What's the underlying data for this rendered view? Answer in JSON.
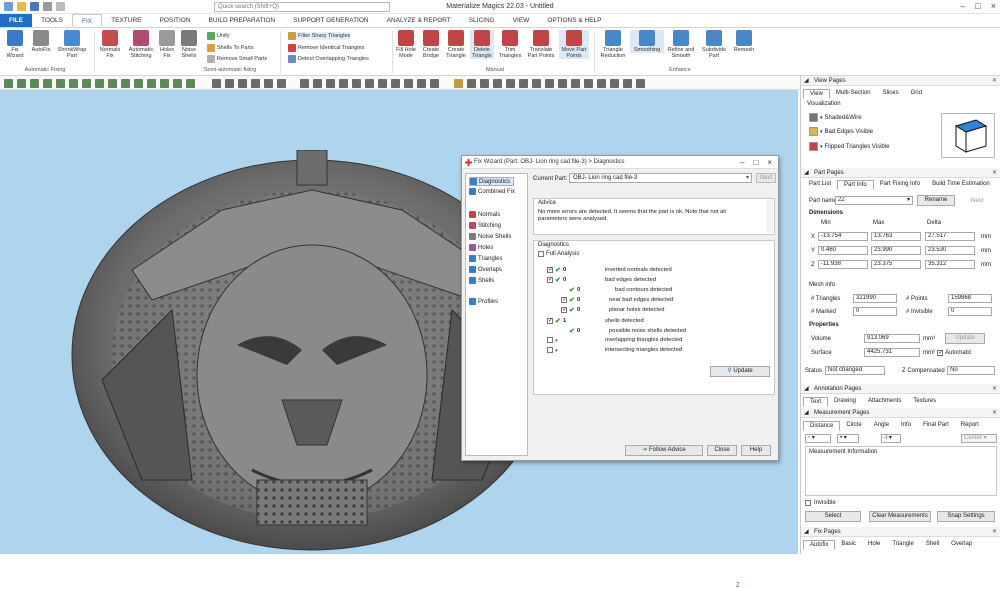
{
  "app": {
    "title": "Materialize Magics 22.03 - Untitled",
    "search_placeholder": "Quick search (Shift+Q)"
  },
  "menu": [
    "FILE",
    "TOOLS",
    "FIX",
    "TEXTURE",
    "POSITION",
    "BUILD PREPARATION",
    "SUPPORT GENERATION",
    "ANALYZE & REPORT",
    "SLICING",
    "VIEW",
    "OPTIONS & HELP"
  ],
  "ribbon": {
    "auto_fixing": {
      "label": "Automatic Fixing",
      "buttons": [
        "Fix Wizard",
        "AutoFix",
        "ShrinkWrap Part"
      ]
    },
    "semi": {
      "label": "Semi-automatic fixing",
      "buttons": [
        "Normals Fix",
        "Automatic Stitching",
        "Holes Fix",
        "Noise Shells"
      ],
      "small": [
        "Unify",
        "Shells To Parts",
        "Remove Small Parts"
      ]
    },
    "filters": [
      "Filter Sharp Triangles",
      "Remove Identical Triangles",
      "Detect Overlapping Triangles"
    ],
    "manual": {
      "label": "Manual",
      "buttons": [
        "Fill Hole Mode",
        "Create Bridge",
        "Create Triangle",
        "Delete Triangle",
        "Trim Triangles",
        "Translate Part Points",
        "Move Part Points"
      ]
    },
    "enhance": {
      "label": "Enhance",
      "buttons": [
        "Triangle Reduction",
        "Smoothing",
        "Refine and Smooth",
        "Subdivide Part",
        "Remesh"
      ]
    }
  },
  "dialog": {
    "title": "Fix Wizard (Part: OBJ- Lion ring cad file-3) > Diagnostics",
    "nav": [
      "Diagnostics",
      "Combined Fix",
      "Normals",
      "Stitching",
      "Noise Shells",
      "Holes",
      "Triangles",
      "Overlaps",
      "Shells",
      "Profiles"
    ],
    "current_part_label": "Current Part:",
    "current_part": "OBJ- Lion ring cad file-3",
    "next": "Next",
    "advice_title": "Advice",
    "advice_text": "No more errors are detected. It seems that the part is ok. Note that not all parameters were analysed.",
    "diag_title": "Diagnostics",
    "full_analysis": "Full Analysis",
    "rows": [
      {
        "count": "0",
        "label": "inverted normals detected"
      },
      {
        "count": "0",
        "label": "bad edges detected"
      },
      {
        "count": "0",
        "label": "bad contours detected"
      },
      {
        "count": "0",
        "label": "near bad edges detected"
      },
      {
        "count": "0",
        "label": "planar holes detected"
      },
      {
        "count": "1",
        "label": "shells detected"
      },
      {
        "count": "0",
        "label": "possible noise shells detected"
      },
      {
        "count": "",
        "label": "overlapping triangles detected"
      },
      {
        "count": "",
        "label": "intersecting triangles detected"
      }
    ],
    "update": "Update",
    "follow_advice": "Follow Advice",
    "close": "Close",
    "help": "Help"
  },
  "viewport": {
    "axis_label": "Z"
  },
  "right": {
    "view_pages": {
      "title": "View Pages",
      "tabs": [
        "View",
        "Multi-Section",
        "Slices",
        "Grid"
      ],
      "visualization": "Visualization",
      "items": [
        "Shaded&Wire",
        "Bad Edges Visible",
        "Flipped Triangles Visible"
      ]
    },
    "part_pages": {
      "title": "Part Pages",
      "tabs": [
        "Part List",
        "Part Info",
        "Part Fixing Info",
        "Build Time Estimation"
      ],
      "part_name_label": "Part name",
      "part_name": "22",
      "rename": "Rename",
      "next": "Next",
      "dimensions": "Dimensions",
      "col_min": "Min",
      "col_max": "Max",
      "col_delta": "Delta",
      "x": {
        "label": "X",
        "min": "-13.754",
        "max": "13.763",
        "delta": "27.517",
        "unit": "mm"
      },
      "y": {
        "label": "Y",
        "min": "0.460",
        "max": "23.990",
        "delta": "23.530",
        "unit": "mm"
      },
      "z": {
        "label": "Z",
        "min": "-11.938",
        "max": "23.375",
        "delta": "35.312",
        "unit": "mm"
      },
      "mesh_info": "Mesh info",
      "triangles_label": "# Triangles",
      "triangles": "321990",
      "points_label": "# Points",
      "points": "159868",
      "marked_label": "# Marked",
      "marked": "0",
      "invisible_label": "# Invisible",
      "invisible": "0",
      "properties": "Properties",
      "volume_label": "Volume",
      "volume": "913.069",
      "volume_unit": "mm³",
      "update": "Update",
      "surface_label": "Surface",
      "surface": "4425.731",
      "surface_unit": "mm²",
      "automatic": "Automatic",
      "status_label": "Status",
      "status": "Not changed",
      "zcomp_label": "Z Compensated",
      "zcomp": "No"
    },
    "annotation": {
      "title": "Annotation Pages",
      "tabs": [
        "Text",
        "Drawing",
        "Attachments",
        "Textures"
      ]
    },
    "measurement": {
      "title": "Measurement Pages",
      "tabs": [
        "Distance",
        "Circle",
        "Angle",
        "Info",
        "Final Part",
        "Report"
      ],
      "center": "Center",
      "info_label": "Measurement Information",
      "invisible": "Invisible",
      "select": "Select",
      "clear": "Clear Measurements",
      "snap": "Snap Settings"
    },
    "fix_pages": {
      "title": "Fix Pages",
      "tabs": [
        "Autofix",
        "Basic",
        "Hole",
        "Triangle",
        "Shell",
        "Overlap"
      ]
    }
  }
}
